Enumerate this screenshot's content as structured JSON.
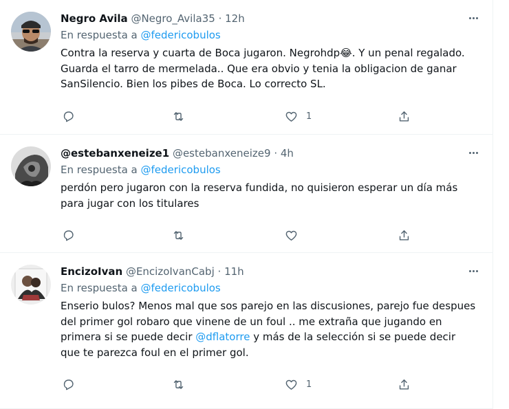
{
  "tweets": [
    {
      "name": "Negro Avila",
      "handle": "@Negro_Avila35",
      "sep": "·",
      "time": "12h",
      "reply_prefix": "En respuesta a",
      "reply_to": "@federicobulos",
      "text_before": "Contra la reserva y cuarta de Boca jugaron. Negrohdp",
      "emoji": "😂",
      "text_after": ". Y un penal regalado. Guarda el tarro de mermelada.. Que era obvio y tenia la obligacion de ganar SanSilencio. Bien los pibes de Boca. Lo correcto SL.",
      "like_count": "1"
    },
    {
      "name": "@estebanxeneize1",
      "handle": "@estebanxeneize9",
      "sep": "·",
      "time": "4h",
      "reply_prefix": "En respuesta a",
      "reply_to": "@federicobulos",
      "text": "perdón pero jugaron con la reserva fundida, no quisieron esperar un día más para jugar con los titulares"
    },
    {
      "name": "EncizoIvan",
      "handle": "@EncizoIvanCabj",
      "sep": "·",
      "time": "11h",
      "reply_prefix": "En respuesta a",
      "reply_to": "@federicobulos",
      "text_before": "Enserio bulos? Menos mal que sos parejo en las discusiones, parejo fue despues del primer gol robaro que vinene de un foul  .. me extraña que jugando en primera si se puede decir ",
      "mention": "@dflatorre",
      "text_after": "  y más de la selección si se puede decir que te parezca foul en el primer gol.",
      "like_count": "1"
    }
  ],
  "icons": {
    "reply": "reply-icon",
    "retweet": "retweet-icon",
    "like": "heart-icon",
    "share": "share-icon",
    "more": "more-icon"
  },
  "colors": {
    "link": "#1d9bf0",
    "secondary_text": "#536471",
    "divider": "#eff3f4"
  }
}
